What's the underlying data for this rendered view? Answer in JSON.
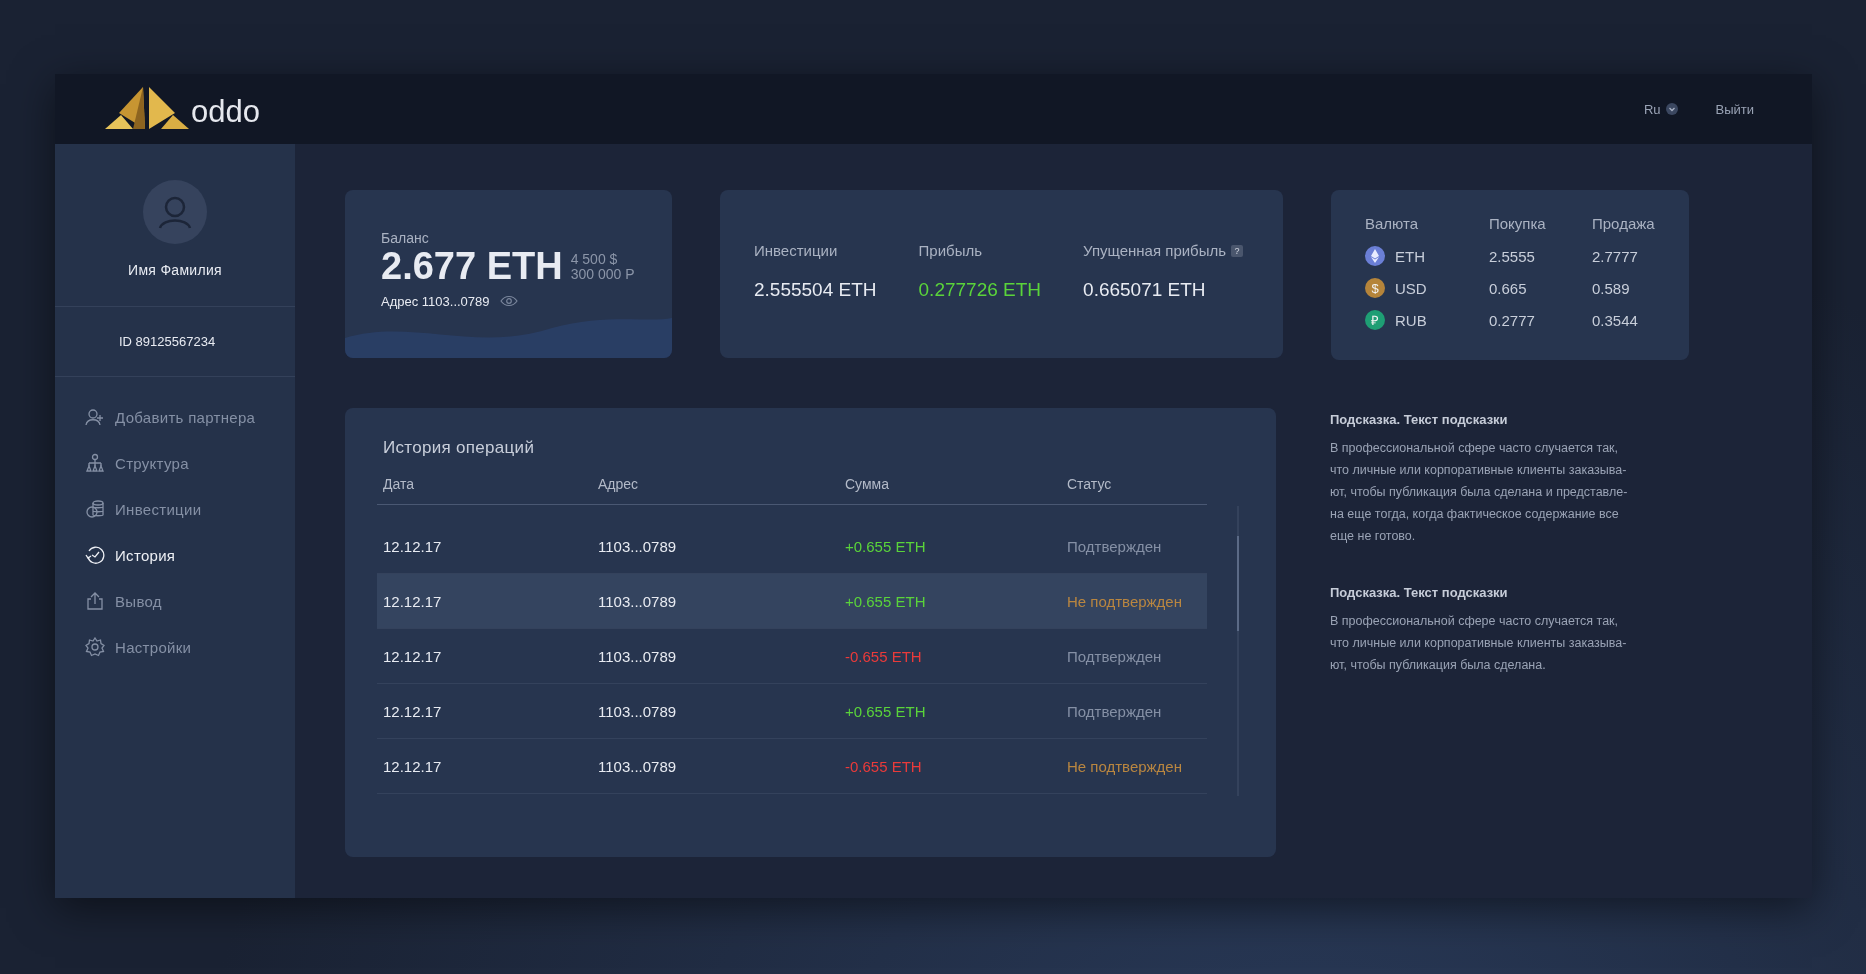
{
  "header": {
    "logo": "oddo",
    "language": "Ru",
    "logout": "Выйти"
  },
  "profile": {
    "name": "Имя Фамилия",
    "id": "ID 89125567234"
  },
  "nav": [
    {
      "label": "Добавить партнера",
      "selected": false
    },
    {
      "label": "Структура",
      "selected": false
    },
    {
      "label": "Инвестиции",
      "selected": false
    },
    {
      "label": "История",
      "selected": true
    },
    {
      "label": "Вывод",
      "selected": false
    },
    {
      "label": "Настройки",
      "selected": false
    }
  ],
  "balance": {
    "label": "Баланс",
    "amount": "2.677 ETH",
    "usd": "4 500 $",
    "rub": "300 000 Р",
    "address": "Адрес 1103...0789"
  },
  "stats": [
    {
      "label": "Инвестиции",
      "value": "2.555504 ETH",
      "positive": false,
      "help": false
    },
    {
      "label": "Прибыль",
      "value": "0.277726 ETH",
      "positive": true,
      "help": false
    },
    {
      "label": "Упущенная прибыль",
      "value": "0.665071 ETH",
      "positive": false,
      "help": true,
      "help_mark": "?"
    }
  ],
  "rates": {
    "columns": [
      "Валюта",
      "Покупка",
      "Продажа"
    ],
    "rows": [
      {
        "kind": "eth",
        "color": "#6b7fd6",
        "currency": "ETH",
        "buy": "2.5555",
        "sell": "2.7777"
      },
      {
        "kind": "symbol",
        "symbol": "$",
        "color": "#b5843a",
        "currency": "USD",
        "buy": "0.665",
        "sell": "0.589"
      },
      {
        "kind": "symbol",
        "symbol": "₽",
        "color": "#1e9e74",
        "currency": "RUB",
        "buy": "0.2777",
        "sell": "0.3544"
      }
    ]
  },
  "history": {
    "title": "История операций",
    "columns": [
      "Дата",
      "Адрес",
      "Сумма",
      "Статус"
    ],
    "rows": [
      {
        "date": "12.12.17",
        "address": "1103...0789",
        "amount": "+0.655 ETH",
        "kind": "income",
        "status": "Подтвержден",
        "confirmed": true,
        "selected": false
      },
      {
        "date": "12.12.17",
        "address": "1103...0789",
        "amount": "+0.655 ETH",
        "kind": "income",
        "status": "Не подтвержден",
        "confirmed": false,
        "selected": true
      },
      {
        "date": "12.12.17",
        "address": "1103...0789",
        "amount": "-0.655 ETH",
        "kind": "expense",
        "status": "Подтвержден",
        "confirmed": true,
        "selected": false
      },
      {
        "date": "12.12.17",
        "address": "1103...0789",
        "amount": "+0.655 ETH",
        "kind": "income",
        "status": "Подтвержден",
        "confirmed": true,
        "selected": false
      },
      {
        "date": "12.12.17",
        "address": "1103...0789",
        "amount": "-0.655 ETH",
        "kind": "expense",
        "status": "Не подтвержден",
        "confirmed": false,
        "selected": false
      }
    ]
  },
  "hints": [
    {
      "title": "Подсказка. Текст подсказки",
      "lines": [
        "В профессиональной сфере часто случается так,",
        "что личные или корпоративные клиенты заказыва-",
        "ют, чтобы публикация была сделана и представле-",
        "на еще тогда, когда фактическое содержание все",
        "еще не готово."
      ]
    },
    {
      "title": "Подсказка. Текст подсказки",
      "lines": [
        "В профессиональной сфере часто случается так,",
        "что личные или корпоративные клиенты заказыва-",
        "ют, чтобы публикация была сделана."
      ]
    }
  ]
}
